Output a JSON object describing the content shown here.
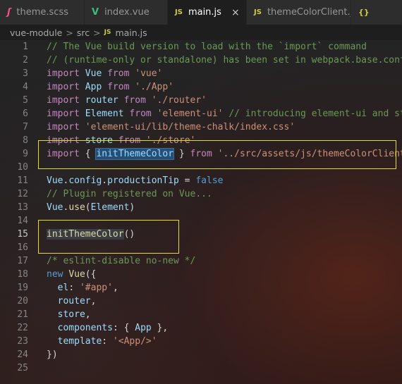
{
  "tabs": [
    {
      "icon": "sass-file-icon",
      "icon_glyph": "ʃ",
      "label": "theme.scss",
      "active": false
    },
    {
      "icon": "vue-file-icon",
      "icon_glyph": "V",
      "label": "index.vue",
      "active": false
    },
    {
      "icon": "js-file-icon",
      "icon_glyph": "JS",
      "label": "main.js",
      "active": true
    },
    {
      "icon": "js-file-icon",
      "icon_glyph": "JS",
      "label": "themeColorClient.js",
      "active": false
    },
    {
      "icon": "json-file-icon",
      "icon_glyph": "{}",
      "label": "",
      "active": false
    }
  ],
  "close_glyph": "×",
  "breadcrumb": {
    "folder1": "vue-module",
    "folder2": "src",
    "file_icon": "JS",
    "file": "main.js",
    "separator": ">"
  },
  "editor": {
    "current_line": 15,
    "lines": [
      {
        "n": "1",
        "tokens": [
          [
            "cm",
            "// The Vue build version to load with the `import` command"
          ]
        ]
      },
      {
        "n": "2",
        "tokens": [
          [
            "cm",
            "// (runtime-only or standalone) has been set in webpack.base.conf"
          ]
        ]
      },
      {
        "n": "3",
        "tokens": [
          [
            "kw",
            "import"
          ],
          [
            "punc",
            " "
          ],
          [
            "var",
            "Vue"
          ],
          [
            "punc",
            " "
          ],
          [
            "kw",
            "from"
          ],
          [
            "punc",
            " "
          ],
          [
            "str",
            "'vue'"
          ]
        ]
      },
      {
        "n": "4",
        "tokens": [
          [
            "kw",
            "import"
          ],
          [
            "punc",
            " "
          ],
          [
            "var",
            "App"
          ],
          [
            "punc",
            " "
          ],
          [
            "kw",
            "from"
          ],
          [
            "punc",
            " "
          ],
          [
            "str",
            "'./App'"
          ]
        ]
      },
      {
        "n": "5",
        "tokens": [
          [
            "kw",
            "import"
          ],
          [
            "punc",
            " "
          ],
          [
            "var",
            "router"
          ],
          [
            "punc",
            " "
          ],
          [
            "kw",
            "from"
          ],
          [
            "punc",
            " "
          ],
          [
            "str",
            "'./router'"
          ]
        ]
      },
      {
        "n": "6",
        "tokens": [
          [
            "kw",
            "import"
          ],
          [
            "punc",
            " "
          ],
          [
            "var",
            "Element"
          ],
          [
            "punc",
            " "
          ],
          [
            "kw",
            "from"
          ],
          [
            "punc",
            " "
          ],
          [
            "str",
            "'element-ui'"
          ],
          [
            "punc",
            " "
          ],
          [
            "cm",
            "// introducing element-ui and sty"
          ]
        ]
      },
      {
        "n": "7",
        "tokens": [
          [
            "kw",
            "import"
          ],
          [
            "punc",
            " "
          ],
          [
            "str",
            "'element-ui/lib/theme-chalk/index.css'"
          ]
        ]
      },
      {
        "n": "8",
        "tokens": [
          [
            "kw",
            "import"
          ],
          [
            "punc",
            " "
          ],
          [
            "var",
            "store"
          ],
          [
            "punc",
            " "
          ],
          [
            "kw",
            "from"
          ],
          [
            "punc",
            " "
          ],
          [
            "str",
            "'./store'"
          ]
        ]
      },
      {
        "n": "9",
        "tokens": [
          [
            "kw",
            "import"
          ],
          [
            "punc",
            " { "
          ],
          [
            "var hl-word",
            "initThemeColor"
          ],
          [
            "punc",
            " } "
          ],
          [
            "kw",
            "from"
          ],
          [
            "punc",
            " "
          ],
          [
            "str",
            "'../src/assets/js/themeColorClient"
          ]
        ]
      },
      {
        "n": "10",
        "tokens": []
      },
      {
        "n": "11",
        "tokens": [
          [
            "var",
            "Vue"
          ],
          [
            "punc",
            "."
          ],
          [
            "var",
            "config"
          ],
          [
            "punc",
            "."
          ],
          [
            "var",
            "productionTip"
          ],
          [
            "punc",
            " = "
          ],
          [
            "kw2",
            "false"
          ]
        ]
      },
      {
        "n": "12",
        "tokens": [
          [
            "cm",
            "// Plugin registered on Vue..."
          ]
        ]
      },
      {
        "n": "13",
        "tokens": [
          [
            "var",
            "Vue"
          ],
          [
            "punc",
            "."
          ],
          [
            "fn",
            "use"
          ],
          [
            "punc",
            "("
          ],
          [
            "var",
            "Element"
          ],
          [
            "punc",
            ")"
          ]
        ]
      },
      {
        "n": "14",
        "tokens": []
      },
      {
        "n": "15",
        "tokens": [
          [
            "fn hl-soft",
            "initThemeColor"
          ],
          [
            "punc",
            "()"
          ]
        ]
      },
      {
        "n": "16",
        "tokens": []
      },
      {
        "n": "17",
        "tokens": [
          [
            "cm",
            "/* eslint-disable no-new */"
          ]
        ]
      },
      {
        "n": "18",
        "tokens": [
          [
            "kw2",
            "new"
          ],
          [
            "punc",
            " "
          ],
          [
            "fn",
            "Vue"
          ],
          [
            "punc",
            "({"
          ]
        ]
      },
      {
        "n": "19",
        "tokens": [
          [
            "punc",
            "  "
          ],
          [
            "var",
            "el"
          ],
          [
            "punc",
            ": "
          ],
          [
            "str",
            "'#app'"
          ],
          [
            "punc",
            ","
          ]
        ]
      },
      {
        "n": "20",
        "tokens": [
          [
            "punc",
            "  "
          ],
          [
            "var",
            "router"
          ],
          [
            "punc",
            ","
          ]
        ]
      },
      {
        "n": "21",
        "tokens": [
          [
            "punc",
            "  "
          ],
          [
            "var",
            "store"
          ],
          [
            "punc",
            ","
          ]
        ]
      },
      {
        "n": "22",
        "tokens": [
          [
            "punc",
            "  "
          ],
          [
            "var",
            "components"
          ],
          [
            "punc",
            ": { "
          ],
          [
            "var",
            "App"
          ],
          [
            "punc",
            " },"
          ]
        ]
      },
      {
        "n": "23",
        "tokens": [
          [
            "punc",
            "  "
          ],
          [
            "var",
            "template"
          ],
          [
            "punc",
            ": "
          ],
          [
            "str",
            "'<App/>'"
          ]
        ]
      },
      {
        "n": "24",
        "tokens": [
          [
            "punc",
            "})"
          ]
        ]
      },
      {
        "n": "25",
        "tokens": []
      }
    ]
  },
  "colors": {
    "annotation_box": "#e5e000",
    "keyword": "#c586c0",
    "string": "#ce9178",
    "comment": "#6a9955",
    "variable": "#9cdcfe",
    "function": "#dcdcaa",
    "constant": "#569cd6"
  }
}
